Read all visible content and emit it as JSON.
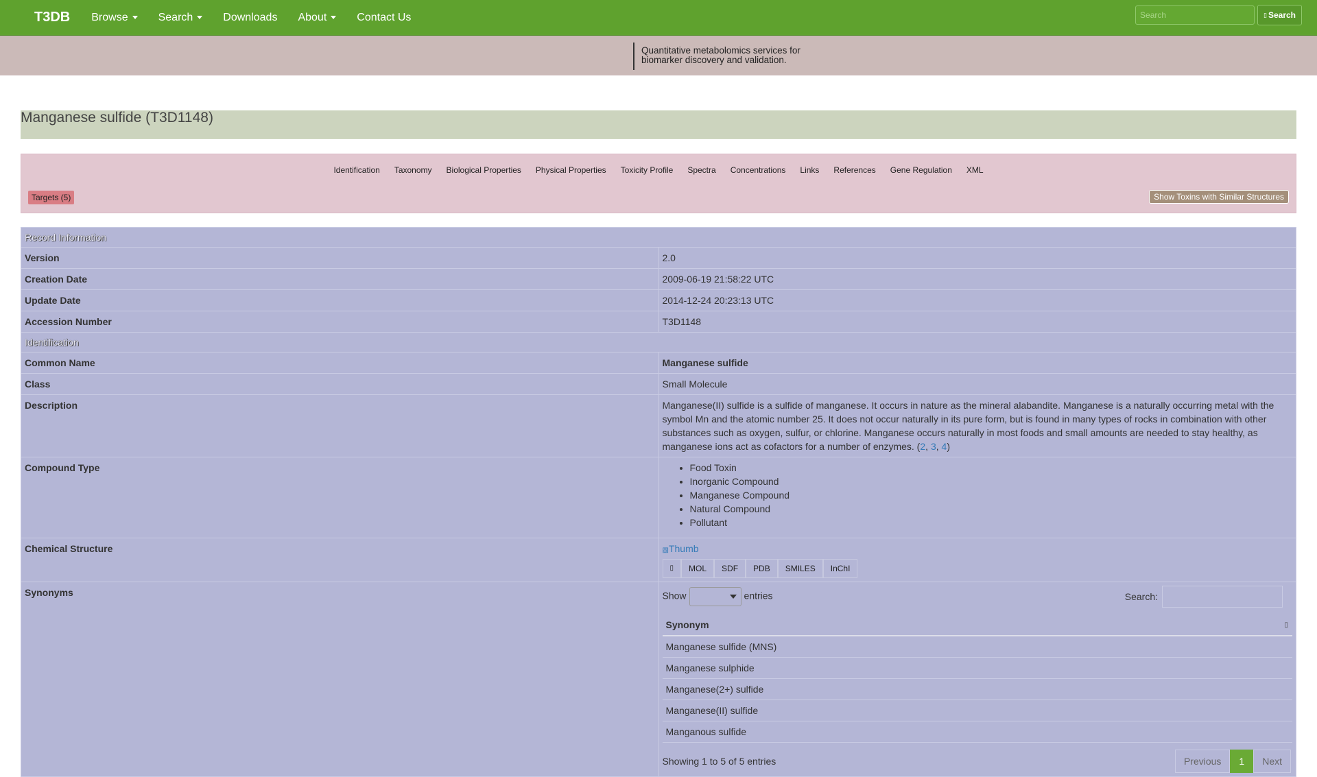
{
  "navbar": {
    "brand": "T3DB",
    "items": [
      {
        "label": "Browse",
        "dropdown": true
      },
      {
        "label": "Search",
        "dropdown": true
      },
      {
        "label": "Downloads",
        "dropdown": false
      },
      {
        "label": "About",
        "dropdown": true
      },
      {
        "label": "Contact Us",
        "dropdown": false
      }
    ],
    "search_placeholder": "Search",
    "search_button": "Search"
  },
  "banner": {
    "line1": "Quantitative metabolomics services for",
    "line2": "biomarker discovery and validation."
  },
  "page_title": "Manganese sulfide (T3D1148)",
  "tabs": [
    "Identification",
    "Taxonomy",
    "Biological Properties",
    "Physical Properties",
    "Toxicity Profile",
    "Spectra",
    "Concentrations",
    "Links",
    "References",
    "Gene Regulation",
    "XML"
  ],
  "targets_button": "Targets (5)",
  "similar_button": "Show Toxins with Similar Structures",
  "record": {
    "section_record": "Record Information",
    "version_label": "Version",
    "version": "2.0",
    "created_label": "Creation Date",
    "created": "2009-06-19 21:58:22 UTC",
    "updated_label": "Update Date",
    "updated": "2014-12-24 20:23:13 UTC",
    "accession_label": "Accession Number",
    "accession": "T3D1148",
    "section_identification": "Identification",
    "common_name_label": "Common Name",
    "common_name": "Manganese sulfide",
    "class_label": "Class",
    "class": "Small Molecule",
    "description_label": "Description",
    "description": "Manganese(II) sulfide is a sulfide of manganese. It occurs in nature as the mineral alabandite. Manganese is a naturally occurring metal with the symbol Mn and the atomic number 25. It does not occur naturally in its pure form, but is found in many types of rocks in combination with other substances such as oxygen, sulfur, or chlorine. Manganese occurs naturally in most foods and small amounts are needed to stay healthy, as manganese ions act as cofactors for a number of enzymes. (",
    "refs": [
      "2",
      "3",
      "4"
    ],
    "desc_close": ")",
    "compound_type_label": "Compound Type",
    "compound_types": [
      "Food Toxin",
      "Inorganic Compound",
      "Manganese Compound",
      "Natural Compound",
      "Pollutant"
    ],
    "structure_label": "Chemical Structure",
    "thumb_alt": "Thumb",
    "structure_formats": [
      "MOL",
      "SDF",
      "PDB",
      "SMILES",
      "InChI"
    ],
    "synonyms_label": "Synonyms"
  },
  "synonyms_table": {
    "show": "Show",
    "entries": "entries",
    "search_label": "Search:",
    "header": "Synonym",
    "rows": [
      "Manganese sulfide (MNS)",
      "Manganese sulphide",
      "Manganese(2+) sulfide",
      "Manganese(II) sulfide",
      "Manganous sulfide"
    ],
    "info": "Showing 1 to 5 of 5 entries",
    "prev": "Previous",
    "page": "1",
    "next": "Next"
  },
  "colors": {
    "navbar": "#5fa22e",
    "banner": "#cbbab8",
    "title_bg": "#ccd4be",
    "tabs_bg": "#e2c7d0",
    "table_bg": "#b4b6d6"
  }
}
